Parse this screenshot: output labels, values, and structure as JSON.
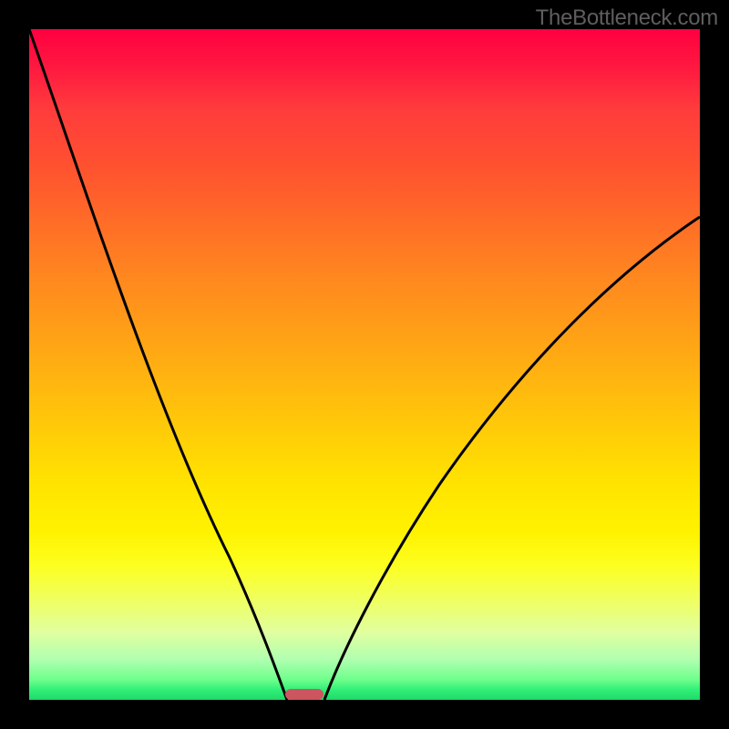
{
  "watermark": "TheBottleneck.com",
  "chart_data": {
    "type": "line",
    "title": "",
    "xlabel": "",
    "ylabel": "",
    "xlim": [
      0,
      100
    ],
    "ylim": [
      0,
      100
    ],
    "gradient_stops": [
      {
        "pos": 0,
        "color": "#ff0040"
      },
      {
        "pos": 20,
        "color": "#ff5030"
      },
      {
        "pos": 40,
        "color": "#ff9c18"
      },
      {
        "pos": 60,
        "color": "#ffcc08"
      },
      {
        "pos": 80,
        "color": "#f0ff60"
      },
      {
        "pos": 100,
        "color": "#20d868"
      }
    ],
    "series": [
      {
        "name": "left",
        "x": [
          0,
          4,
          8,
          12,
          16,
          20,
          24,
          28,
          32,
          36,
          38.5
        ],
        "y": [
          100,
          87,
          74,
          62,
          50,
          39,
          29,
          20,
          12,
          5,
          0
        ]
      },
      {
        "name": "right",
        "x": [
          44,
          48,
          52,
          56,
          60,
          64,
          68,
          72,
          76,
          80,
          84,
          88,
          92,
          96,
          100
        ],
        "y": [
          0,
          6,
          12,
          18,
          24,
          30,
          36,
          42,
          48,
          53,
          58,
          62,
          66,
          69,
          72
        ]
      }
    ],
    "marker": {
      "x_center": 41,
      "y": 0,
      "width": 6,
      "color": "#cc5560"
    }
  }
}
